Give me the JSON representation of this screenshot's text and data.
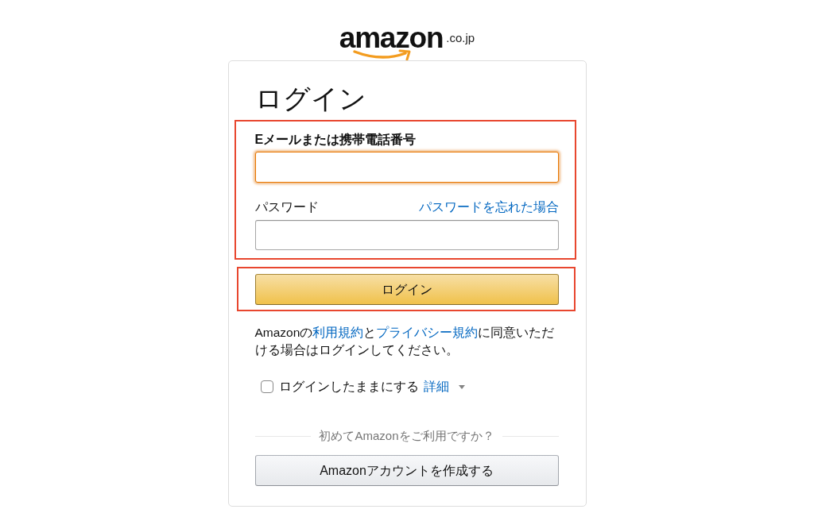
{
  "logo": {
    "wordmark": "amazon",
    "domain": ".co.jp"
  },
  "card": {
    "title": "ログイン",
    "credentials": {
      "highlighted": true,
      "email": {
        "label": "Eメールまたは携帯電話番号",
        "focused": true
      },
      "password": {
        "label": "パスワード",
        "forgot_link": "パスワードを忘れた場合",
        "focused": false
      }
    },
    "submit": {
      "highlighted": true,
      "label": "ログイン"
    },
    "terms": [
      {
        "kind": "text",
        "text": "Amazonの"
      },
      {
        "kind": "link",
        "text": "利用規約"
      },
      {
        "kind": "text",
        "text": "と"
      },
      {
        "kind": "link",
        "text": "プライバシー規約"
      },
      {
        "kind": "text",
        "text": "に同意いただける場合はログインしてください。"
      }
    ],
    "keep_signed_in": {
      "label": "ログインしたままにする",
      "checked": false,
      "details_link": "詳細"
    },
    "new_customer": {
      "prompt": "初めてAmazonをご利用ですか？",
      "button": "Amazonアカウントを作成する"
    }
  }
}
